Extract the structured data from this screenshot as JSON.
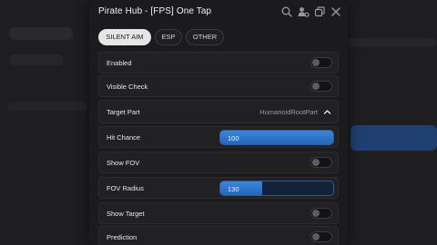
{
  "window": {
    "title": "Pirate Hub - [FPS] One Tap"
  },
  "tabs": [
    {
      "label": "SILENT AIM",
      "active": true
    },
    {
      "label": "ESP",
      "active": false
    },
    {
      "label": "OTHER",
      "active": false
    }
  ],
  "options": {
    "enabled": {
      "label": "Enabled",
      "on": false
    },
    "visible_check": {
      "label": "Visible Check",
      "on": false
    },
    "target_part": {
      "label": "Target Part",
      "value": "HumanoidRootPart"
    },
    "hit_chance": {
      "label": "Hit Chance",
      "value": "100",
      "fill": 1.0
    },
    "show_fov": {
      "label": "Show FOV",
      "on": false
    },
    "fov_radius": {
      "label": "FOV Radius",
      "value": "130",
      "fill": 0.37
    },
    "show_target": {
      "label": "Show Target",
      "on": false
    },
    "prediction": {
      "label": "Prediction",
      "on": false
    }
  },
  "colors": {
    "accent": "#2f7bd0",
    "background": "#1b1b1d"
  },
  "icons": [
    "search-icon",
    "user-settings-icon",
    "copy-icon",
    "close-icon",
    "chevron-up-icon"
  ]
}
